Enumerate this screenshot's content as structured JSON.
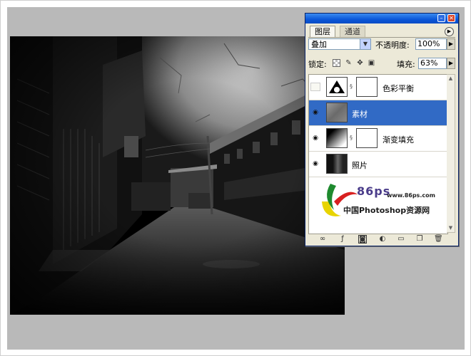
{
  "panel": {
    "tabs": [
      {
        "label": "图层"
      },
      {
        "label": "通道"
      }
    ],
    "blend_mode": "叠加",
    "opacity_label": "不透明度:",
    "opacity_value": "100%",
    "lock_label": "锁定:",
    "fill_label": "填充:",
    "fill_value": "63%",
    "layers": [
      {
        "name": "色彩平衡",
        "visible": false,
        "selected": false,
        "has_mask": true
      },
      {
        "name": "素材",
        "visible": true,
        "selected": true,
        "has_mask": false
      },
      {
        "name": "渐变填充",
        "visible": true,
        "selected": false,
        "has_mask": true
      },
      {
        "name": "照片",
        "visible": true,
        "selected": false,
        "has_mask": false
      }
    ]
  },
  "watermark": {
    "brand": "86ps",
    "url": "www.86ps.com",
    "tagline": "中国Photoshop资源网"
  },
  "colors": {
    "selection": "#316ac5",
    "panel_bg": "#ece9d8",
    "workspace_bg": "#b9b9b9"
  }
}
